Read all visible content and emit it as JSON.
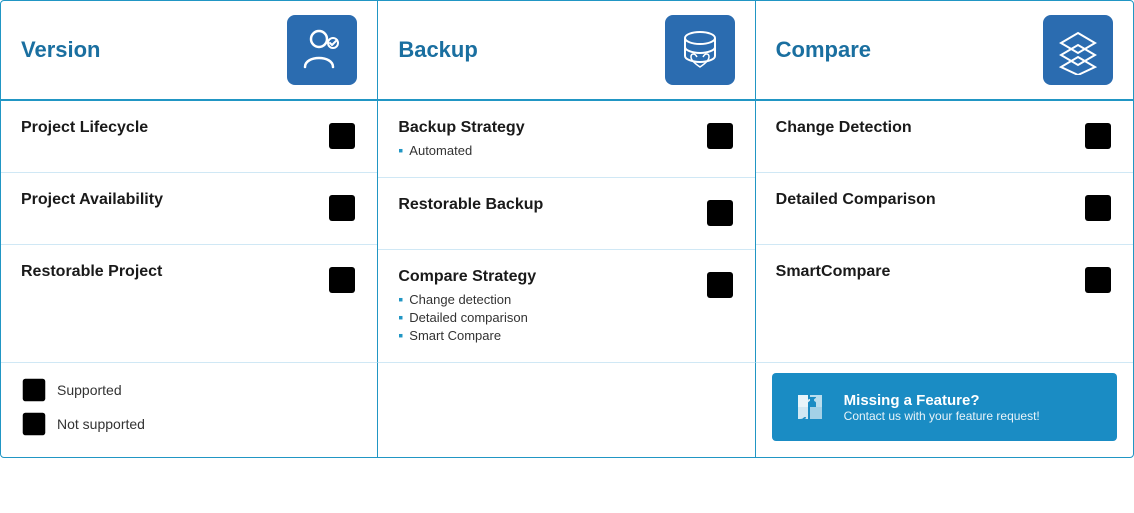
{
  "header": {
    "cols": [
      {
        "title": "Version",
        "icon": "person-icon"
      },
      {
        "title": "Backup",
        "icon": "database-icon"
      },
      {
        "title": "Compare",
        "icon": "layers-icon"
      }
    ]
  },
  "columns": [
    {
      "features": [
        {
          "name": "Project Lifecycle",
          "sublist": [],
          "supported": true
        },
        {
          "name": "Project Availability",
          "sublist": [],
          "supported": true
        },
        {
          "name": "Restorable Project",
          "sublist": [],
          "supported": true
        }
      ]
    },
    {
      "features": [
        {
          "name": "Backup Strategy",
          "sublist": [
            "Automated"
          ],
          "supported": true
        },
        {
          "name": "Restorable Backup",
          "sublist": [],
          "supported": false
        },
        {
          "name": "Compare Strategy",
          "sublist": [
            "Change detection",
            "Detailed comparison",
            "Smart Compare"
          ],
          "supported": true
        }
      ]
    },
    {
      "features": [
        {
          "name": "Change Detection",
          "sublist": [],
          "supported": true
        },
        {
          "name": "Detailed Comparison",
          "sublist": [],
          "supported": true
        },
        {
          "name": "SmartCompare",
          "sublist": [],
          "supported": true
        }
      ]
    }
  ],
  "legend": {
    "supported_label": "Supported",
    "not_supported_label": "Not supported"
  },
  "missing_feature": {
    "title": "Missing a Feature?",
    "subtitle": "Contact us with your feature request!"
  }
}
